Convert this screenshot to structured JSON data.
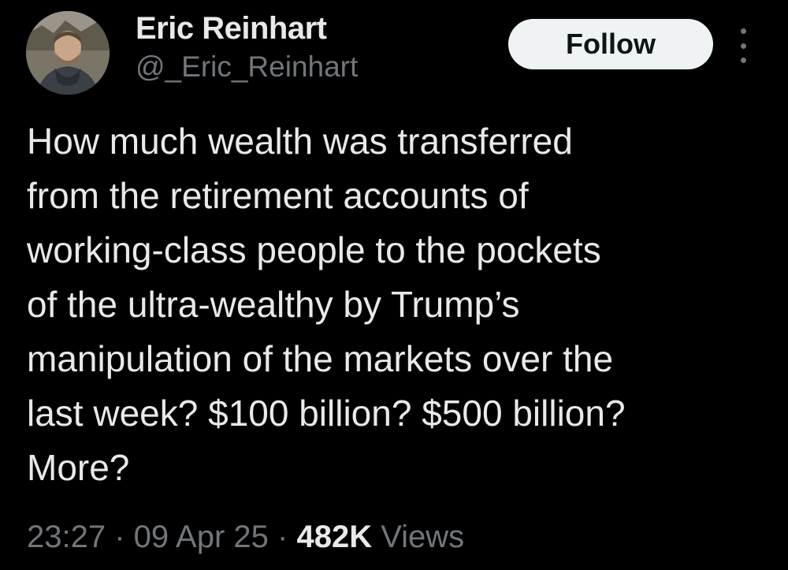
{
  "author": {
    "display_name": "Eric Reinhart",
    "handle": "@_Eric_Reinhart",
    "avatar_icon": "user-avatar-photo"
  },
  "actions": {
    "follow_label": "Follow",
    "more_icon": "more-vertical-icon"
  },
  "tweet": {
    "lines": [
      "How much wealth was transferred",
      "from the retirement accounts of",
      "working-class people to the pockets",
      "of the ultra-wealthy by Trump’s",
      "manipulation of the markets over the",
      "last week? $100 billion? $500 billion?",
      "More?"
    ]
  },
  "meta": {
    "time": "23:27",
    "separator": " · ",
    "date": "09 Apr 25",
    "views_count": "482K",
    "views_label": "Views"
  },
  "colors": {
    "background": "#000000",
    "primary_text": "#e7e9ea",
    "secondary_text": "#71767b",
    "follow_button_bg": "#eff3f4",
    "follow_button_text": "#0f1419"
  }
}
